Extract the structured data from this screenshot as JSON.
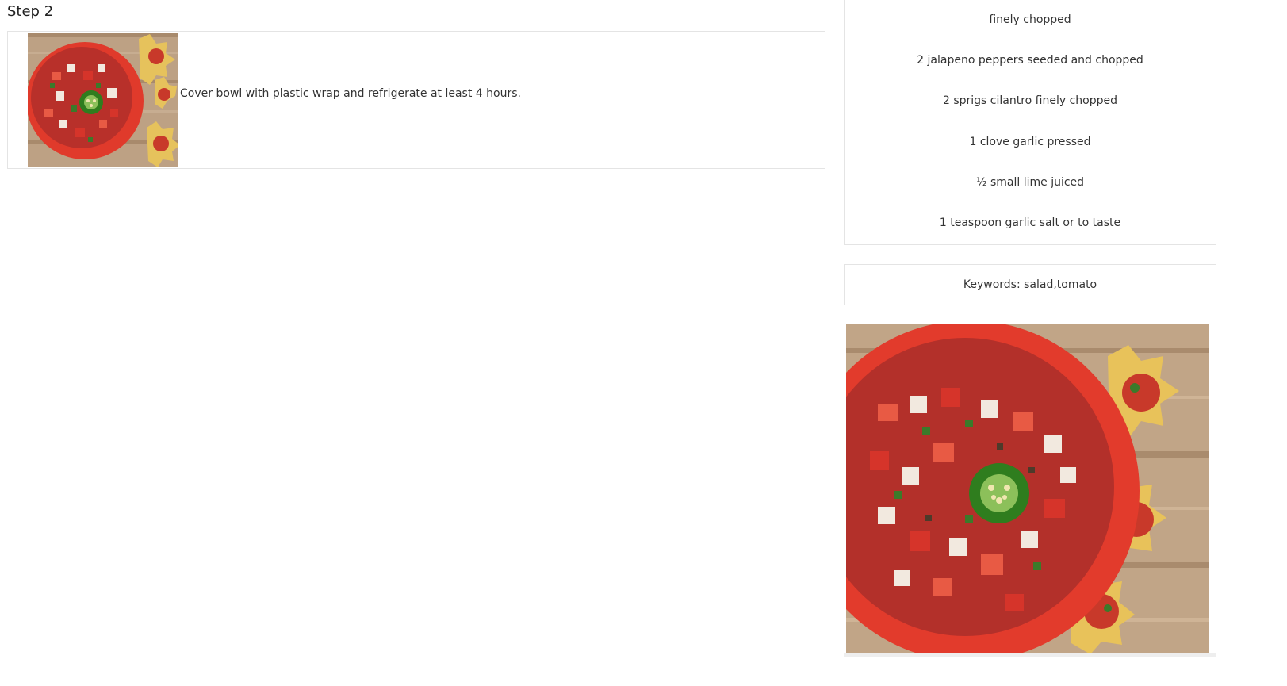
{
  "step": {
    "title": "Step 2",
    "text": "Cover bowl with plastic wrap and refrigerate at least 4 hours.",
    "thumbnail_alt": "salsa-bowl-image"
  },
  "ingredients": [
    "finely chopped",
    "2 jalapeno peppers seeded and chopped",
    "2 sprigs cilantro finely chopped",
    "1 clove garlic pressed",
    "½ small lime juiced",
    "1 teaspoon garlic salt or to taste"
  ],
  "keywords": {
    "text": "Keywords: salad,tomato"
  },
  "hero": {
    "alt": "salsa-bowl-image"
  },
  "colors": {
    "bowl_red": "#e8392a",
    "wood": "#b89878",
    "jalapeno": "#2f7d1e",
    "chip": "#e8c25a",
    "border": "#e4e4e4"
  }
}
